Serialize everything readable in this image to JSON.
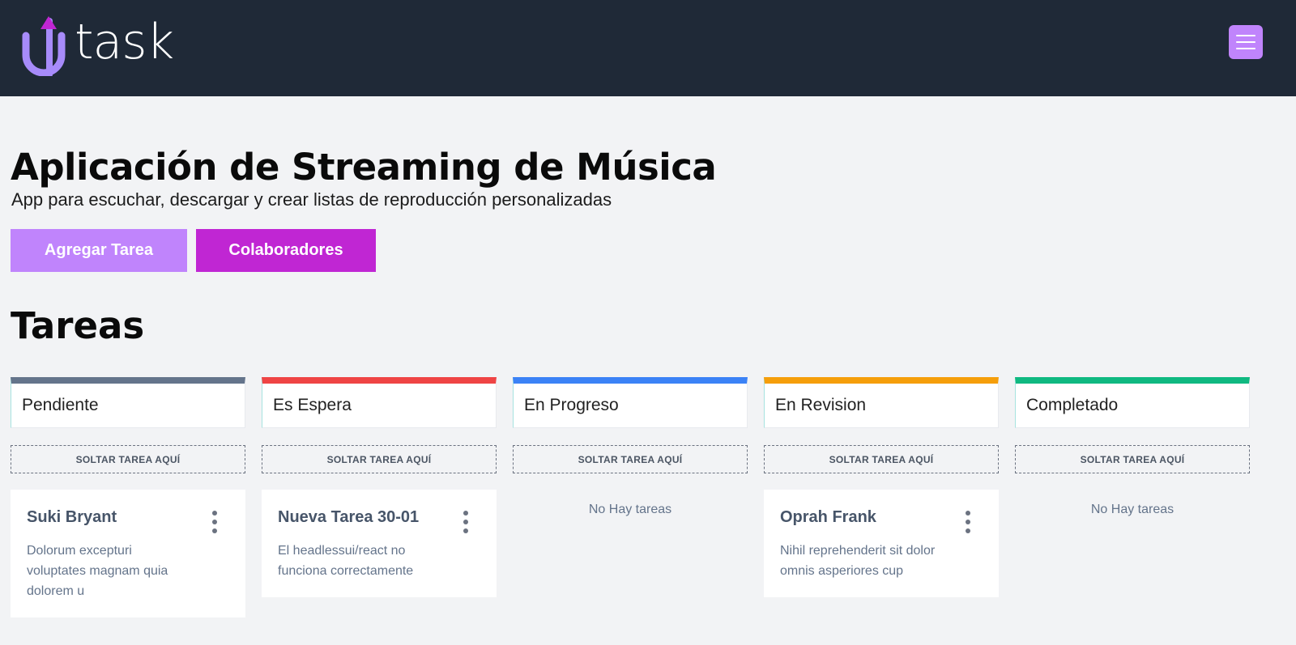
{
  "header": {
    "logo_text": "uptask",
    "menu_icon": "hamburger-icon",
    "colors": {
      "background": "#1f2937",
      "accent": "#c084fc"
    }
  },
  "project": {
    "title": "Aplicación de Streaming de Música",
    "description": "App para escuchar, descargar y crear listas de reproducción personalizadas"
  },
  "actions": {
    "add_task": "Agregar Tarea",
    "collaborators": "Colaboradores"
  },
  "tasks_section": {
    "title": "Tareas",
    "dropzone_label": "SOLTAR TAREA AQUÍ",
    "empty_label": "No Hay tareas",
    "columns": [
      {
        "name": "Pendiente",
        "color": "#64748b",
        "tasks": [
          {
            "title": "Suki Bryant",
            "description": "Dolorum excepturi voluptates magnam quia dolorem u"
          }
        ]
      },
      {
        "name": "Es Espera",
        "color": "#ef4444",
        "tasks": [
          {
            "title": "Nueva Tarea 30-01",
            "description": "El headlessui/react no funciona correctamente"
          }
        ]
      },
      {
        "name": "En Progreso",
        "color": "#3b82f6",
        "tasks": []
      },
      {
        "name": "En Revision",
        "color": "#f59e0b",
        "tasks": [
          {
            "title": "Oprah Frank",
            "description": "Nihil reprehenderit sit dolor omnis asperiores cup"
          }
        ]
      },
      {
        "name": "Completado",
        "color": "#10b981",
        "tasks": []
      }
    ]
  }
}
